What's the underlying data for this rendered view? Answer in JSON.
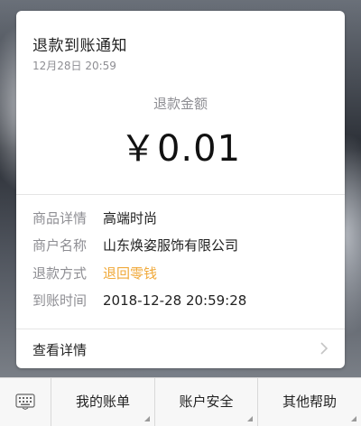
{
  "card": {
    "title": "退款到账通知",
    "time": "12月28日  20:59",
    "amount_label": "退款金额",
    "amount": "￥0.01",
    "rows": [
      {
        "key": "商品详情",
        "value": "高端时尚"
      },
      {
        "key": "商户名称",
        "value": "山东焕姿服饰有限公司"
      },
      {
        "key": "退款方式",
        "value": "退回零钱"
      },
      {
        "key": "到账时间",
        "value": "2018-12-28 20:59:28"
      }
    ],
    "details_label": "查看详情"
  },
  "bottom_menu": {
    "keyboard_icon": "keyboard-icon",
    "items": [
      {
        "label": "我的账单"
      },
      {
        "label": "账户安全"
      },
      {
        "label": "其他帮助"
      }
    ]
  },
  "colors": {
    "accent_orange": "#f0a93a",
    "muted_gray": "#8e8e93"
  }
}
